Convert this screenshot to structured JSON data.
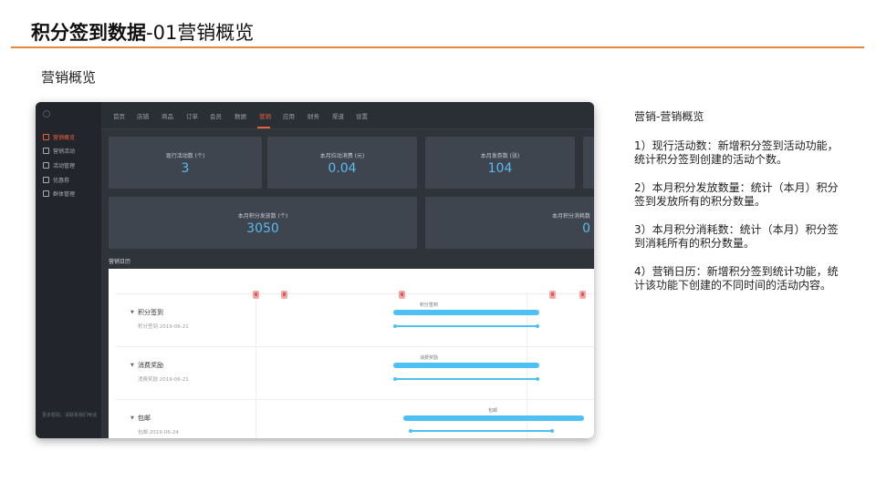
{
  "slide": {
    "title_bold": "积分签到数据",
    "title_rest": "-01营销概览",
    "section_label": "营销概览"
  },
  "app": {
    "nav": [
      "首页",
      "店铺",
      "商品",
      "订单",
      "会员",
      "数据",
      "营销",
      "应用",
      "财务",
      "渠道",
      "设置"
    ],
    "nav_active": 6,
    "sidebar": [
      {
        "label": "营销概览",
        "icon": "home-icon",
        "active": true
      },
      {
        "label": "营销活动",
        "icon": "tag-icon",
        "active": false
      },
      {
        "label": "活动管理",
        "icon": "calendar-icon",
        "active": false
      },
      {
        "label": "优惠券",
        "icon": "coupon-icon",
        "active": false
      },
      {
        "label": "群体管理",
        "icon": "group-icon",
        "active": false
      }
    ],
    "sidebar_footer": "更多帮助，请联系我们电话",
    "stats_row1": [
      {
        "label": "现行活动数 (个)",
        "value": "3"
      },
      {
        "label": "本月拉动消费 (元)",
        "value": "0.04"
      },
      {
        "label": "本月发券数 (张)",
        "value": "104"
      }
    ],
    "stats_row2": [
      {
        "label": "本月积分发放数 (个)",
        "value": "3050"
      },
      {
        "label": "本月积分消耗数",
        "value": "0"
      }
    ],
    "calendar_title": "营销日历",
    "calendar_rows": [
      {
        "name": "积分签到",
        "sub": "积分签到  2019-06-21",
        "bar_label": "积分签到"
      },
      {
        "name": "消费奖励",
        "sub": "消费奖励  2019-06-21",
        "bar_label": "消费奖励"
      },
      {
        "name": "包邮",
        "sub": "包邮  2019-06-24",
        "bar_label": "包邮"
      }
    ],
    "colors": {
      "accent": "#e8603c",
      "value": "#59b9f0",
      "bar": "#4cc1f2"
    }
  },
  "description": {
    "heading": "营销-营销概览",
    "points": [
      "1）现行活动数：新增积分签到活动功能，统计积分签到创建的活动个数。",
      "2）本月积分发放数量：统计（本月）积分签到发放所有的积分数量。",
      "3）本月积分消耗数：统计（本月）积分签到消耗所有的积分数量。",
      "4）营销日历：新增积分签到统计功能，统计该功能下创建的不同时间的活动内容。"
    ]
  }
}
